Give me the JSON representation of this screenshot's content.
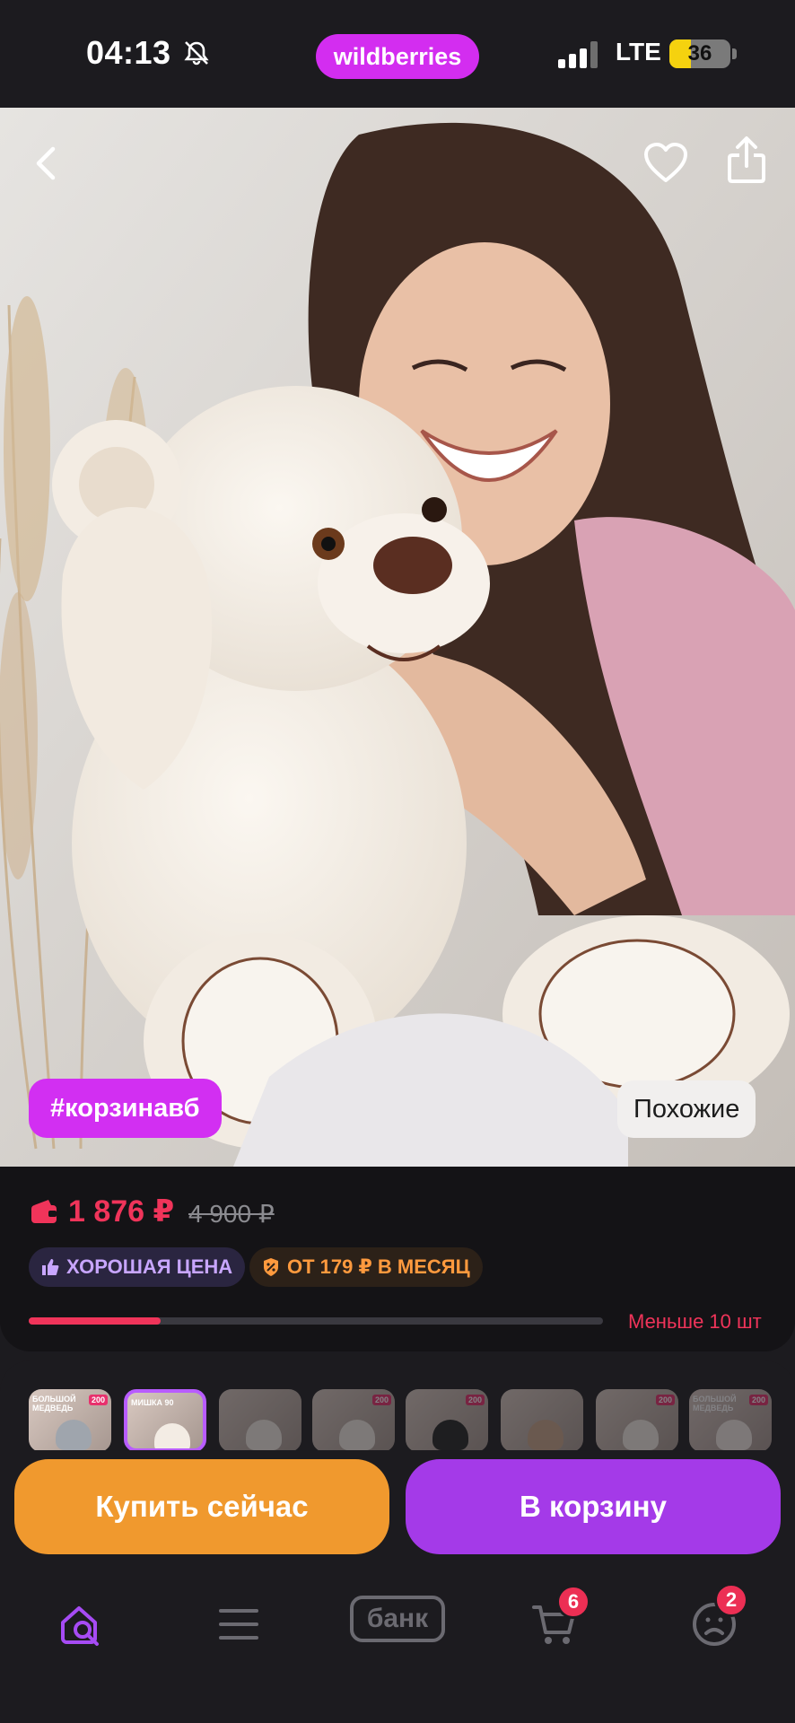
{
  "status_bar": {
    "time": "04:13",
    "brand": "wildberries",
    "network": "LTE",
    "battery": "36",
    "battery_level": 0.36,
    "icons": [
      "bell-off-icon",
      "signal-icon",
      "battery-icon"
    ]
  },
  "product": {
    "hashtag": "#корзинавб",
    "similar_label": "Похожие",
    "price": "1 876 ₽",
    "old_price": "4 900 ₽",
    "badge_good": "ХОРОШАЯ ЦЕНА",
    "badge_installment": "ОТ 179 ₽ В МЕСЯЦ",
    "stock_label": "Меньше 10 шт",
    "stock_level": 0.23
  },
  "thumbnails": [
    {
      "caption": "БОЛЬШОЙ МЕДВЕДЬ",
      "tag": "200"
    },
    {
      "caption": "МИШКА 90",
      "tag": ""
    },
    {
      "caption": "",
      "tag": ""
    },
    {
      "caption": "",
      "tag": "200"
    },
    {
      "caption": "",
      "tag": "200"
    },
    {
      "caption": "",
      "tag": ""
    },
    {
      "caption": "",
      "tag": "200"
    },
    {
      "caption": "БОЛЬШОЙ МЕДВЕДЬ",
      "tag": "200"
    }
  ],
  "actions": {
    "buy_now": "Купить сейчас",
    "add_to_cart": "В корзину"
  },
  "tabbar": {
    "bank": "банк",
    "cart_count": "6",
    "profile_count": "2"
  },
  "colors": {
    "brand": "#d32df0",
    "price": "#f0345a",
    "buy_now": "#f0992e",
    "add_to_cart": "#a43ae8"
  }
}
